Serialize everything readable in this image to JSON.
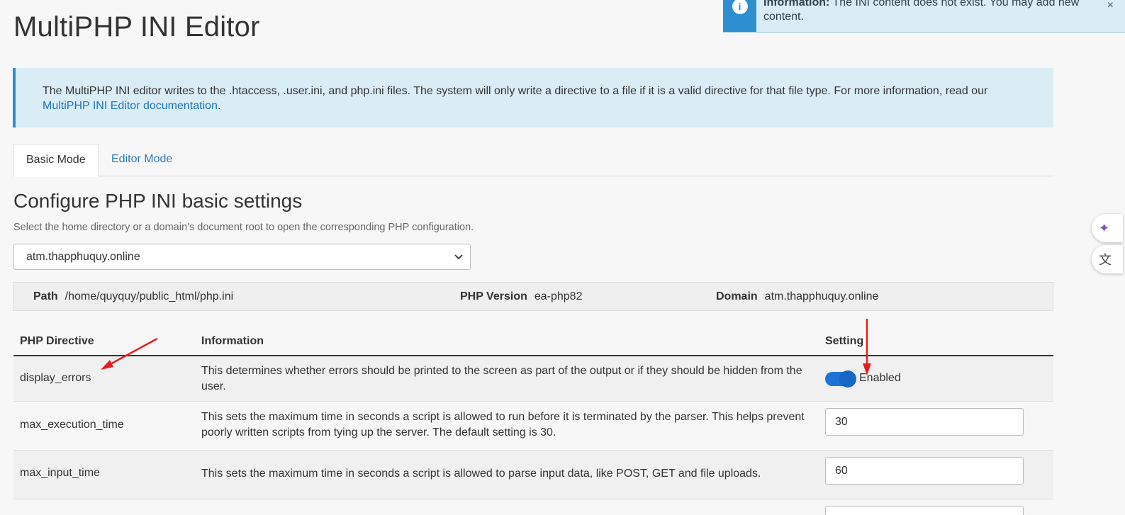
{
  "page": {
    "title": "MultiPHP INI Editor"
  },
  "notification": {
    "icon": "info-icon",
    "label": "Information:",
    "message": "The INI content does not exist. You may add new content.",
    "close_symbol": "×"
  },
  "info_banner": {
    "text": "The MultiPHP INI editor writes to the .htaccess, .user.ini, and php.ini files. The system will only write a directive to a file if it is a valid directive for that file type. For more information, read our",
    "link_text": "MultiPHP INI Editor documentation",
    "suffix": "."
  },
  "tabs": [
    {
      "label": "Basic Mode",
      "active": true
    },
    {
      "label": "Editor Mode",
      "active": false
    }
  ],
  "section": {
    "title": "Configure PHP INI basic settings",
    "subtitle": "Select the home directory or a domain’s document root to open the corresponding PHP configuration."
  },
  "domain_select": {
    "value": "atm.thapphuquy.online"
  },
  "meta": {
    "path_label": "Path",
    "path_value": "/home/quyquy/public_html/php.ini",
    "php_version_label": "PHP Version",
    "php_version_value": "ea-php82",
    "domain_label": "Domain",
    "domain_value": "atm.thapphuquy.online"
  },
  "table": {
    "headers": [
      "PHP Directive",
      "Information",
      "Setting"
    ],
    "rows": [
      {
        "directive": "display_errors",
        "info": "This determines whether errors should be printed to the screen as part of the output or if they should be hidden from the user.",
        "setting_type": "toggle",
        "enabled": true,
        "setting_label": "Enabled"
      },
      {
        "directive": "max_execution_time",
        "info": "This sets the maximum time in seconds a script is allowed to run before it is terminated by the parser. This helps prevent poorly written scripts from tying up the server. The default setting is 30.",
        "setting_type": "input",
        "value": "30"
      },
      {
        "directive": "max_input_time",
        "info": "This sets the maximum time in seconds a script is allowed to parse input data, like POST, GET and file uploads.",
        "setting_type": "input",
        "value": "60"
      }
    ]
  },
  "colors": {
    "accent": "#2d8fcf",
    "link": "#1e74b8",
    "toggle_on": "#1e74d6",
    "annotation_arrow": "#e02020"
  },
  "side_buttons": [
    {
      "icon": "sparkle-icon",
      "glyph": "✦"
    },
    {
      "icon": "translate-icon",
      "glyph": "文"
    }
  ]
}
